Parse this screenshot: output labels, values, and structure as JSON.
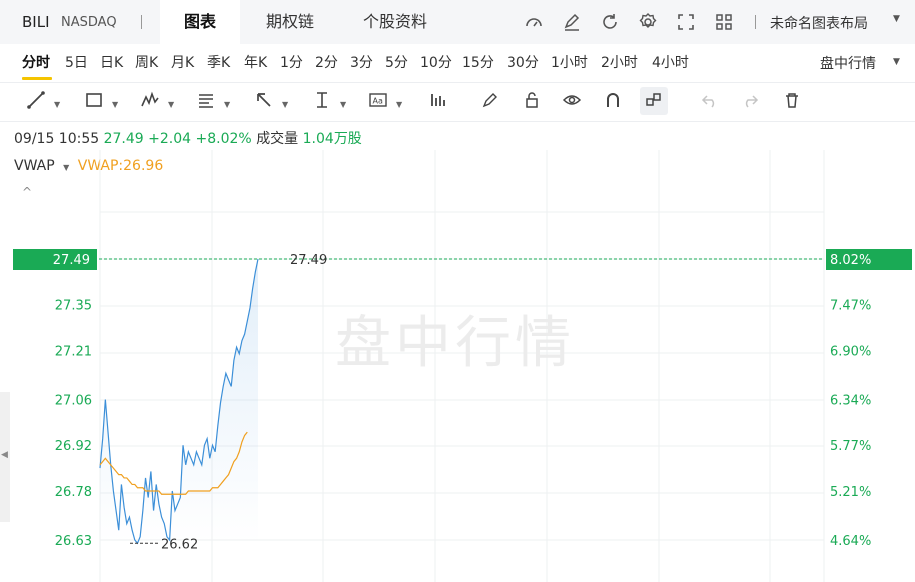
{
  "header": {
    "symbol": "BILI",
    "exchange": "NASDAQ",
    "separator": "|",
    "tabs": [
      "图表",
      "期权链",
      "个股资料"
    ],
    "icons": [
      "gauge-icon",
      "edit-icon",
      "refresh-icon",
      "gear-icon",
      "fullscreen-icon",
      "grid-icon"
    ],
    "layout_label": "未命名图表布局"
  },
  "periods": [
    "分时",
    "5日",
    "日K",
    "周K",
    "月K",
    "季K",
    "年K",
    "1分",
    "2分",
    "3分",
    "5分",
    "10分",
    "15分",
    "30分",
    "1小时",
    "2小时",
    "4小时"
  ],
  "active_period": "分时",
  "session_label": "盘中行情",
  "toolbar": [
    "line-tool-icon",
    "rectangle-tool-icon",
    "pattern-tool-icon",
    "fib-tool-icon",
    "arrow-tool-icon",
    "measure-tool-icon",
    "text-tool-icon",
    "bar-chart-icon",
    "pencil-icon",
    "lock-icon",
    "eye-icon",
    "magnet-icon",
    "link-icon",
    "undo-icon",
    "redo-icon",
    "trash-icon"
  ],
  "info": {
    "datetime": "09/15 10:55",
    "price": "27.49",
    "change": "+2.04",
    "change_pct": "+8.02%",
    "volume_label": "成交量",
    "volume_value": "1.04万股"
  },
  "indicator": {
    "name": "VWAP",
    "value_label": "VWAP:26.96",
    "collapse_glyph": "^"
  },
  "watermark": "盘中行情",
  "colors": {
    "up": "#1aaa55",
    "vwap": "#f0a020",
    "price_line": "#3c8fd8",
    "accent": "#f5c400"
  },
  "chart_data": {
    "type": "line",
    "y_ticks": [
      "27.49",
      "27.35",
      "27.21",
      "27.06",
      "26.92",
      "26.78",
      "26.63"
    ],
    "y_tick_values": [
      27.49,
      27.35,
      27.21,
      27.06,
      26.92,
      26.78,
      26.63
    ],
    "pct_ticks": [
      "8.02%",
      "7.47%",
      "6.90%",
      "6.34%",
      "5.77%",
      "5.21%",
      "4.64%"
    ],
    "ylim": [
      26.63,
      27.49
    ],
    "current_price": 27.49,
    "current_label": "27.49",
    "low_price": 26.62,
    "low_label": "26.62",
    "grid": true,
    "x_points": 60,
    "series": [
      {
        "name": "price",
        "values": [
          26.85,
          26.94,
          27.06,
          26.96,
          26.86,
          26.78,
          26.72,
          26.66,
          26.8,
          26.73,
          26.68,
          26.7,
          26.66,
          26.63,
          26.62,
          26.64,
          26.72,
          26.82,
          26.76,
          26.84,
          26.72,
          26.8,
          26.74,
          26.7,
          26.68,
          26.64,
          26.63,
          26.78,
          26.72,
          26.74,
          26.76,
          26.92,
          26.86,
          26.9,
          26.88,
          26.86,
          26.9,
          26.88,
          26.86,
          26.92,
          26.94,
          26.88,
          26.92,
          26.9,
          26.98,
          27.05,
          27.1,
          27.14,
          27.12,
          27.1,
          27.18,
          27.22,
          27.2,
          27.24,
          27.26,
          27.3,
          27.34,
          27.4,
          27.45,
          27.49
        ]
      },
      {
        "name": "VWAP",
        "values": [
          26.86,
          26.87,
          26.88,
          26.87,
          26.86,
          26.85,
          26.84,
          26.83,
          26.83,
          26.82,
          26.82,
          26.81,
          26.8,
          26.8,
          26.79,
          26.79,
          26.79,
          26.78,
          26.78,
          26.78,
          26.78,
          26.78,
          26.78,
          26.77,
          26.77,
          26.77,
          26.77,
          26.77,
          26.77,
          26.77,
          26.77,
          26.77,
          26.77,
          26.78,
          26.78,
          26.78,
          26.78,
          26.78,
          26.78,
          26.78,
          26.78,
          26.78,
          26.79,
          26.79,
          26.79,
          26.8,
          26.81,
          26.82,
          26.83,
          26.85,
          26.87,
          26.88,
          26.9,
          26.93,
          26.95,
          26.96
        ]
      }
    ]
  }
}
